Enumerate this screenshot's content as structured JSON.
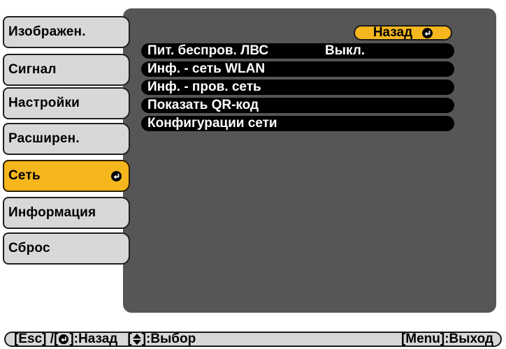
{
  "tabs": [
    {
      "label": "Изображен.",
      "active": false
    },
    {
      "label": "Сигнал",
      "active": false
    },
    {
      "label": "Настройки",
      "active": false
    },
    {
      "label": "Расширен.",
      "active": false
    },
    {
      "label": "Сеть",
      "active": true
    },
    {
      "label": "Информация",
      "active": false
    },
    {
      "label": "Сброс",
      "active": false
    }
  ],
  "back_label": "Назад",
  "menu": [
    {
      "label": "Пит. беспров. ЛВС",
      "value": "Выкл."
    },
    {
      "label": "Инф. - сеть WLAN",
      "value": ""
    },
    {
      "label": "Инф. - пров. сеть",
      "value": ""
    },
    {
      "label": "Показать QR-код",
      "value": ""
    },
    {
      "label": "Конфигурации сети",
      "value": ""
    }
  ],
  "status": {
    "esc_prefix": "[Esc] /[",
    "esc_suffix": "]:Назад",
    "select_prefix": "[",
    "select_suffix": "]:Выбор",
    "exit": "[Menu]:Выход"
  },
  "colors": {
    "panel": "#565656",
    "tab": "#d8d8d8",
    "active": "#f5b61e",
    "row": "#000000"
  },
  "icons": {
    "enter": "enter-icon",
    "updown": "up-down-arrow-icon"
  }
}
